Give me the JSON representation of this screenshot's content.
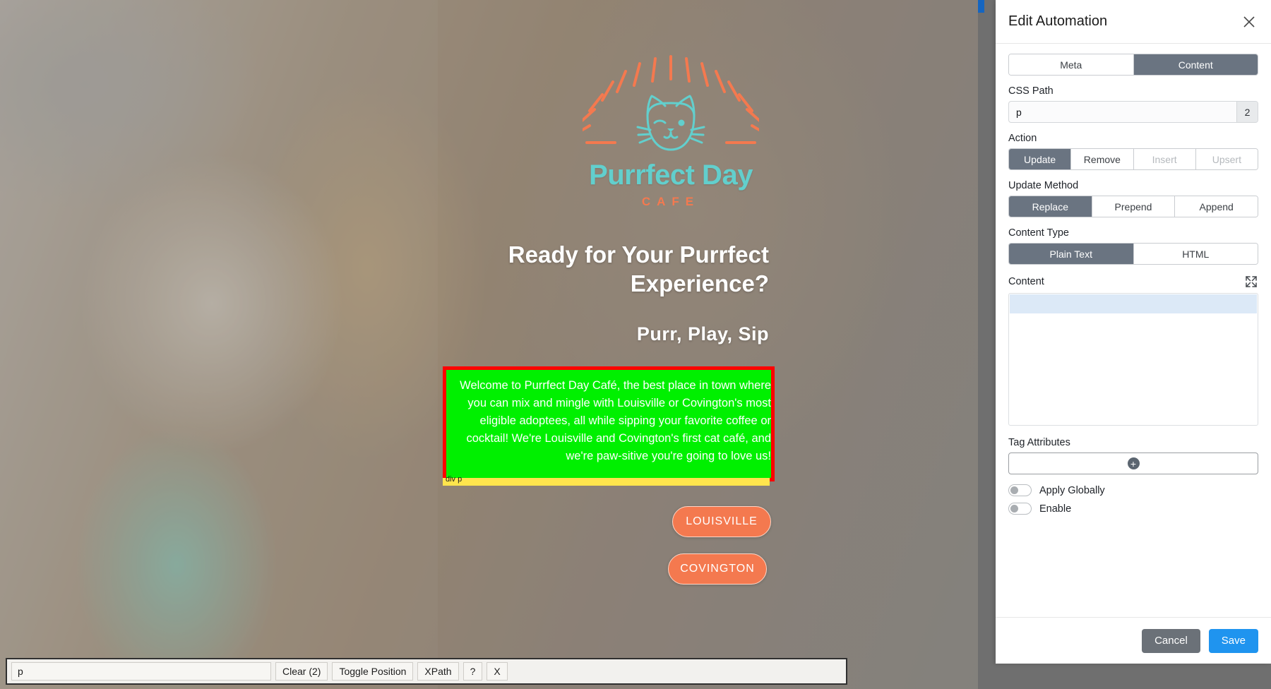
{
  "webpage": {
    "logo": {
      "name": "Purrfect Day",
      "subtitle": "CAFE",
      "cat_icon": "cat-face-icon",
      "sun_icon": "sunburst-icon"
    },
    "hero_heading": "Ready for Your Purrfect Experience?",
    "hero_tagline": "Purr, Play, Sip",
    "selected_paragraph": "Welcome to Purrfect Day Café, the best place in town where you can mix and mingle with Louisville or Covington's most eligible adoptees, all while sipping your favorite coffee or cocktail! We're Louisville and Covington's first cat café, and we're paw-sitive you're going to love us!",
    "selection_label": "div p",
    "cta_buttons": [
      {
        "label": "LOUISVILLE"
      },
      {
        "label": "COVINGTON"
      }
    ],
    "colors": {
      "selection_outline": "#ff0000",
      "selection_fill": "#00f000",
      "selection_label_bar": "#ffe54d",
      "brand_orange": "#f4794f",
      "brand_teal": "#62cfcd"
    }
  },
  "devtoolbar": {
    "selector_value": "p",
    "selector_placeholder": "",
    "buttons": [
      {
        "label": "Clear (2)",
        "name": "clear-button"
      },
      {
        "label": "Toggle Position",
        "name": "toggle-position-button"
      },
      {
        "label": "XPath",
        "name": "xpath-button"
      },
      {
        "label": "?",
        "name": "help-button"
      },
      {
        "label": "X",
        "name": "close-toolbar-button"
      }
    ]
  },
  "panel": {
    "title": "Edit Automation",
    "close_icon": "close-icon",
    "tabs": [
      {
        "label": "Meta",
        "active": false
      },
      {
        "label": "Content",
        "active": true
      }
    ],
    "css_path": {
      "label": "CSS Path",
      "value": "p",
      "placeholder": "",
      "match_count": "2"
    },
    "action": {
      "label": "Action",
      "options": [
        {
          "label": "Update",
          "state": "active"
        },
        {
          "label": "Remove",
          "state": "enabled"
        },
        {
          "label": "Insert",
          "state": "disabled"
        },
        {
          "label": "Upsert",
          "state": "disabled"
        }
      ]
    },
    "update_method": {
      "label": "Update Method",
      "options": [
        {
          "label": "Replace",
          "state": "active"
        },
        {
          "label": "Prepend",
          "state": "enabled"
        },
        {
          "label": "Append",
          "state": "enabled"
        }
      ]
    },
    "content_type": {
      "label": "Content Type",
      "options": [
        {
          "label": "Plain Text",
          "state": "active"
        },
        {
          "label": "HTML",
          "state": "enabled"
        }
      ]
    },
    "content": {
      "label": "Content",
      "expand_icon": "expand-icon",
      "value": "",
      "placeholder": ""
    },
    "tag_attributes": {
      "label": "Tag Attributes",
      "add_icon": "plus-icon"
    },
    "toggles": [
      {
        "label": "Apply Globally",
        "on": false
      },
      {
        "label": "Enable",
        "on": false
      }
    ],
    "footer": {
      "cancel_label": "Cancel",
      "save_label": "Save"
    },
    "colors": {
      "segment_active": "#6a7481",
      "save_blue": "#1f94ef",
      "cancel_gray": "#6b7178"
    }
  }
}
